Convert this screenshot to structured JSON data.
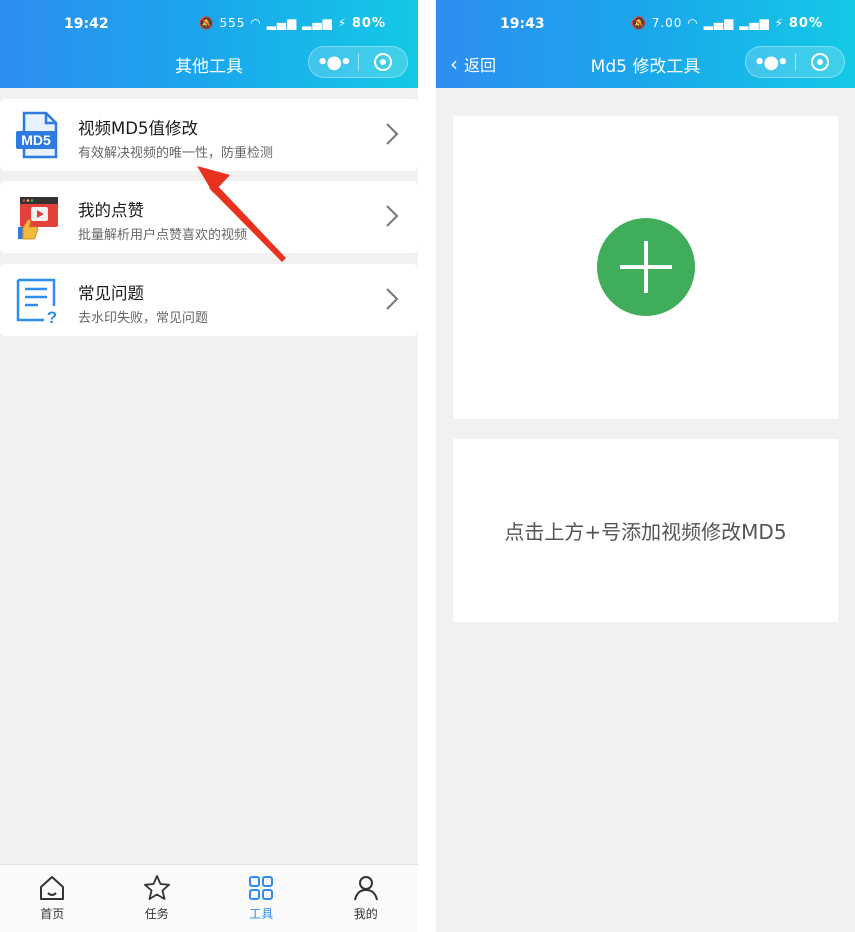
{
  "left_screen": {
    "status": {
      "time": "19:42",
      "net_speed": "555",
      "battery": "80%"
    },
    "title": "其他工具",
    "menu": [
      {
        "title": "视频MD5值修改",
        "subtitle": "有效解决视频的唯一性，防重检测",
        "icon": "md5-file-icon",
        "icon_text": "MD5"
      },
      {
        "title": "我的点赞",
        "subtitle": "批量解析用户点赞喜欢的视频",
        "icon": "like-video-icon"
      },
      {
        "title": "常见问题",
        "subtitle": "去水印失败，常见问题",
        "icon": "faq-document-icon"
      }
    ],
    "tabs": [
      {
        "label": "首页",
        "icon": "home-icon",
        "active": false
      },
      {
        "label": "任务",
        "icon": "star-icon",
        "active": false
      },
      {
        "label": "工具",
        "icon": "grid-icon",
        "active": true
      },
      {
        "label": "我的",
        "icon": "person-icon",
        "active": false
      }
    ]
  },
  "right_screen": {
    "status": {
      "time": "19:43",
      "net_speed": "7.00",
      "battery": "80%"
    },
    "back_label": "返回",
    "title": "Md5 修改工具",
    "hint": "点击上方+号添加视频修改MD5"
  },
  "colors": {
    "header_start": "#2d8ef0",
    "header_end": "#14c9e6",
    "add_button": "#3fad5a",
    "tab_active": "#2d8ef0",
    "annotation_arrow": "#e8321e"
  }
}
